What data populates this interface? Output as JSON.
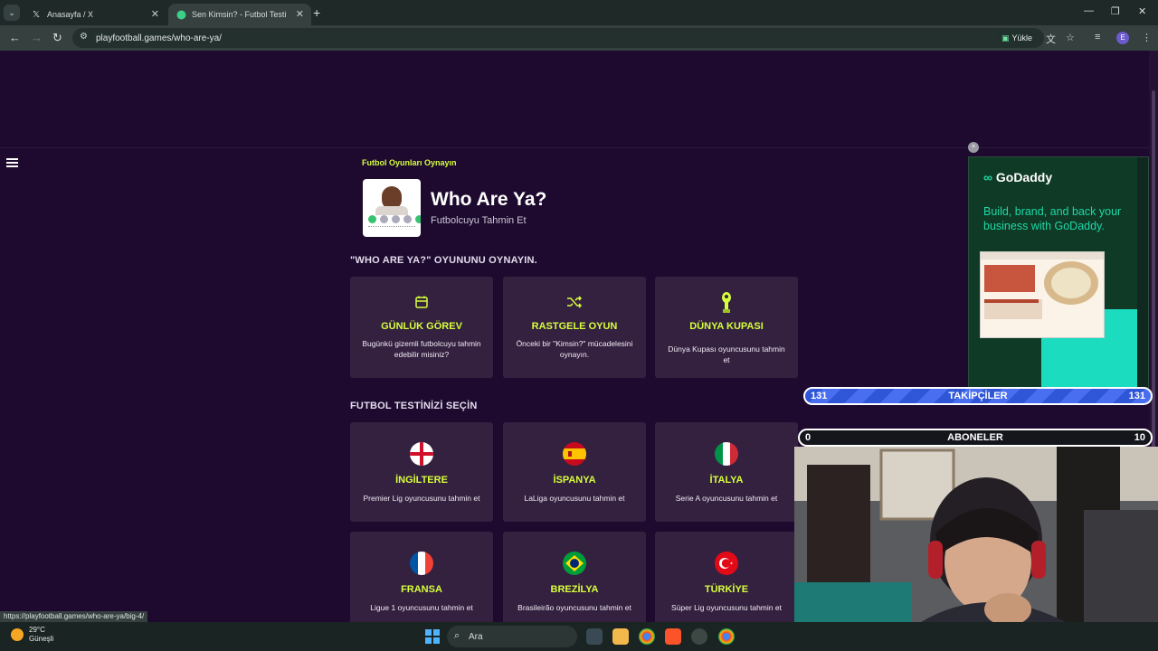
{
  "browser": {
    "tabs": [
      {
        "title": "Anasayfa / X",
        "icon": "x-logo-icon"
      },
      {
        "title": "Sen Kimsin? - Futbol Testi",
        "icon": "site-favicon"
      }
    ],
    "url": "playfootball.games/who-are-ya/",
    "upload_label": "Yükle",
    "status_url": "https://playfootball.games/who-are-ya/big-4/"
  },
  "header": {
    "eyebrow": "Futbol Oyunları Oynayın",
    "title": "Who Are Ya?",
    "subtitle": "Futbolcuyu Tahmin Et"
  },
  "modes": {
    "heading": "\"WHO ARE YA?\" OYUNUNU OYNAYIN.",
    "cards": [
      {
        "title": "GÜNLÜK GÖREV",
        "desc": "Bugünkü gizemli futbolcuyu tahmin edebilir misiniz?",
        "icon": "calendar-icon"
      },
      {
        "title": "RASTGELE OYUN",
        "desc": "Önceki bir \"Kimsin?\" mücadelesini oynayın.",
        "icon": "shuffle-icon"
      },
      {
        "title": "DÜNYA KUPASI",
        "desc": "Dünya Kupası oyuncusunu tahmin et",
        "icon": "trophy-icon"
      }
    ]
  },
  "quizzes": {
    "heading": "FUTBOL TESTİNİZİ SEÇİN",
    "cards": [
      {
        "title": "İNGİLTERE",
        "desc": "Premier Lig oyuncusunu tahmin et",
        "flag": "england"
      },
      {
        "title": "İSPANYA",
        "desc": "LaLiga oyuncusunu tahmin et",
        "flag": "spain"
      },
      {
        "title": "İTALYA",
        "desc": "Serie A oyuncusunu tahmin et",
        "flag": "italy"
      },
      {
        "title": "FRANSA",
        "desc": "Ligue 1 oyuncusunu tahmin et",
        "flag": "france"
      },
      {
        "title": "BREZİLYA",
        "desc": "Brasileirão oyuncusunu tahmin et",
        "flag": "brazil"
      },
      {
        "title": "TÜRKİYE",
        "desc": "Süper Lig oyuncusunu tahmin et",
        "flag": "turkey"
      }
    ]
  },
  "ad": {
    "brand": "GoDaddy",
    "text": "Build, brand, and back your business with GoDaddy."
  },
  "stream_overlay": {
    "followers_label": "TAKİPÇİLER",
    "followers_left": "131",
    "followers_right": "131",
    "subs_label": "ABONELER",
    "subs_left": "0",
    "subs_right": "10"
  },
  "taskbar": {
    "temp": "29°C",
    "weather": "Güneşli",
    "search": "Ara"
  },
  "colors": {
    "page_bg": "#1d0a2e",
    "card_bg": "#34203f",
    "accent": "#d6ff3b"
  }
}
